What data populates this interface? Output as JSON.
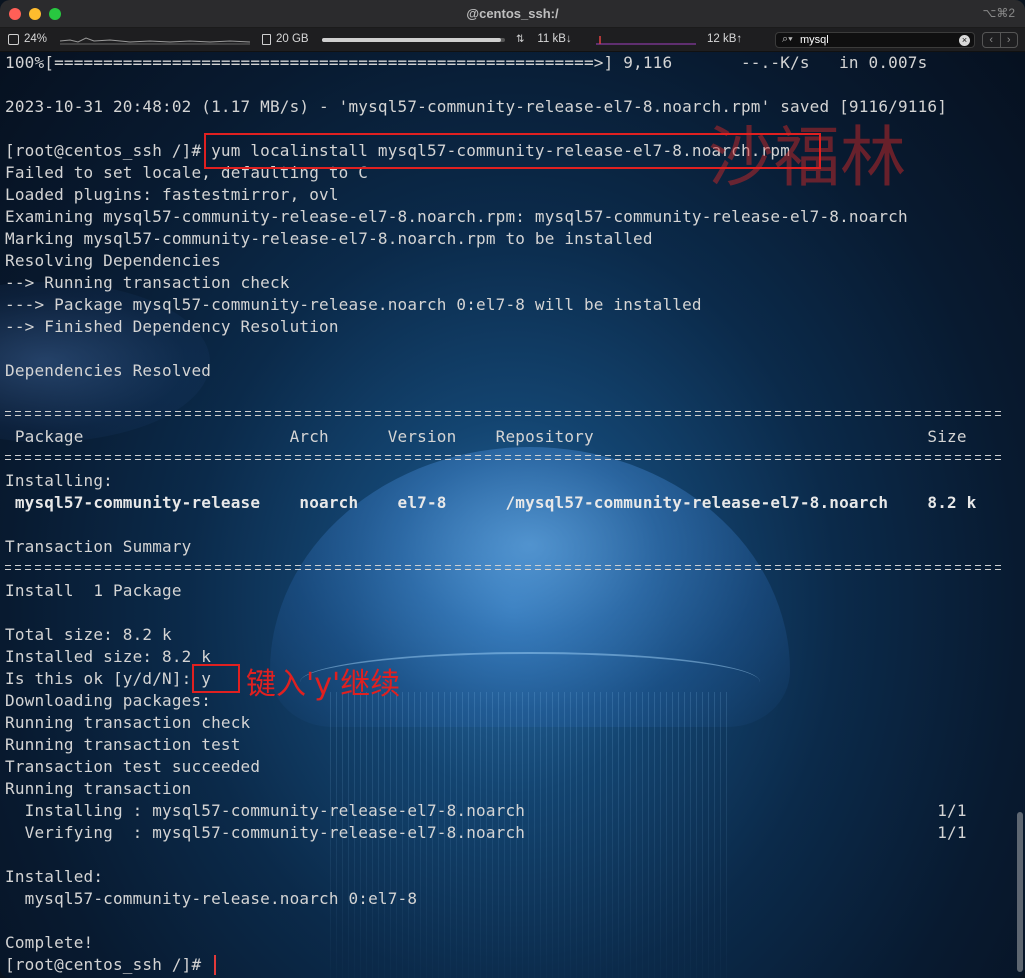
{
  "window": {
    "title": "@centos_ssh:/",
    "shortcut": "⌥⌘2"
  },
  "statusbar": {
    "cpu": "24%",
    "memory": "20 GB",
    "memory_used_fraction": 0.98,
    "net_down": "11 kB↓",
    "net_up": "12 kB↑",
    "search_value": "mysql",
    "search_icon": "magnifier-icon"
  },
  "annotations": {
    "watermark": "沙福林",
    "hint": "键入'y'继续"
  },
  "terminal": {
    "lines": [
      "100%[=======================================================>] 9,116       --.-K/s   in 0.007s",
      "",
      "2023-10-31 20:48:02 (1.17 MB/s) - 'mysql57-community-release-el7-8.noarch.rpm' saved [9116/9116]",
      "",
      "[root@centos_ssh /]# yum localinstall mysql57-community-release-el7-8.noarch.rpm",
      "Failed to set locale, defaulting to C",
      "Loaded plugins: fastestmirror, ovl",
      "Examining mysql57-community-release-el7-8.noarch.rpm: mysql57-community-release-el7-8.noarch",
      "Marking mysql57-community-release-el7-8.noarch.rpm to be installed",
      "Resolving Dependencies",
      "--> Running transaction check",
      "---> Package mysql57-community-release.noarch 0:el7-8 will be installed",
      "--> Finished Dependency Resolution",
      "",
      "Dependencies Resolved",
      "",
      "",
      " Package                     Arch      Version    Repository                                  Size",
      "",
      "Installing:",
      " mysql57-community-release    noarch    el7-8      /mysql57-community-release-el7-8.noarch    8.2 k",
      "",
      "Transaction Summary",
      "",
      "Install  1 Package",
      "",
      "Total size: 8.2 k",
      "Installed size: 8.2 k",
      "Is this ok [y/d/N]: y",
      "Downloading packages:",
      "Running transaction check",
      "Running transaction test",
      "Transaction test succeeded",
      "Running transaction",
      "  Installing : mysql57-community-release-el7-8.noarch                                          1/1",
      "  Verifying  : mysql57-community-release-el7-8.noarch                                          1/1",
      "",
      "Installed:",
      "  mysql57-community-release.noarch 0:el7-8",
      "",
      "Complete!",
      "[root@centos_ssh /]# "
    ]
  }
}
